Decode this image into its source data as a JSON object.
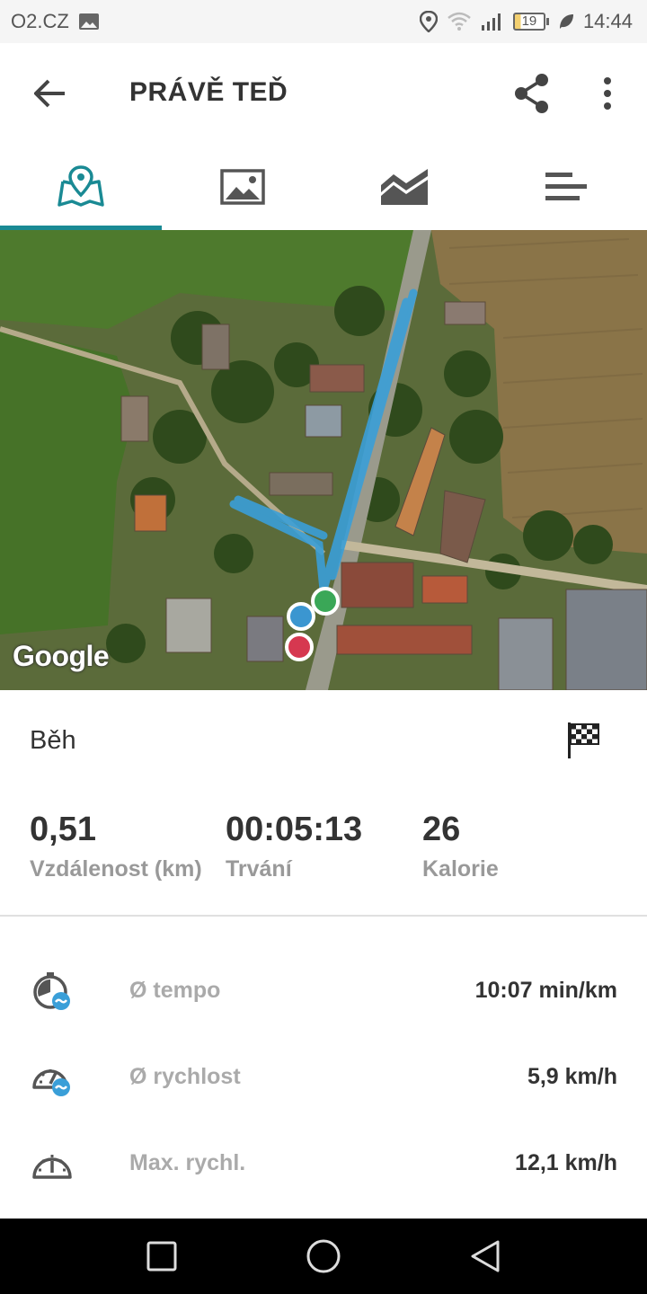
{
  "status_bar": {
    "carrier": "O2.CZ",
    "battery": "19",
    "time": "14:44"
  },
  "app_bar": {
    "title": "PRÁVĚ TEĎ",
    "back_icon": "arrow-back-icon",
    "share_icon": "share-icon",
    "more_icon": "more-vert-icon"
  },
  "tabs": [
    {
      "name": "map",
      "icon": "map-pin-icon",
      "active": true
    },
    {
      "name": "photos",
      "icon": "image-icon",
      "active": false
    },
    {
      "name": "charts",
      "icon": "area-chart-icon",
      "active": false
    },
    {
      "name": "laps",
      "icon": "bars-icon",
      "active": false
    }
  ],
  "map": {
    "attribution": "Google",
    "route_color": "#3a9fd8"
  },
  "activity": {
    "name": "Běh",
    "flag_icon": "checkered-flag-icon"
  },
  "summary": [
    {
      "value": "0,51",
      "label": "Vzdálenost (km)"
    },
    {
      "value": "00:05:13",
      "label": "Trvání"
    },
    {
      "value": "26",
      "label": "Kalorie"
    }
  ],
  "stats": [
    {
      "label": "Ø tempo",
      "value": "10:07 min/km",
      "icon": "pace-icon"
    },
    {
      "label": "Ø rychlost",
      "value": "5,9 km/h",
      "icon": "avg-speed-icon"
    },
    {
      "label": "Max. rychl.",
      "value": "12,1 km/h",
      "icon": "speedometer-icon"
    }
  ],
  "colors": {
    "accent": "#1a8a94",
    "marker_start": "#3aa757",
    "marker_current": "#3b96d0",
    "marker_end": "#d63850"
  }
}
